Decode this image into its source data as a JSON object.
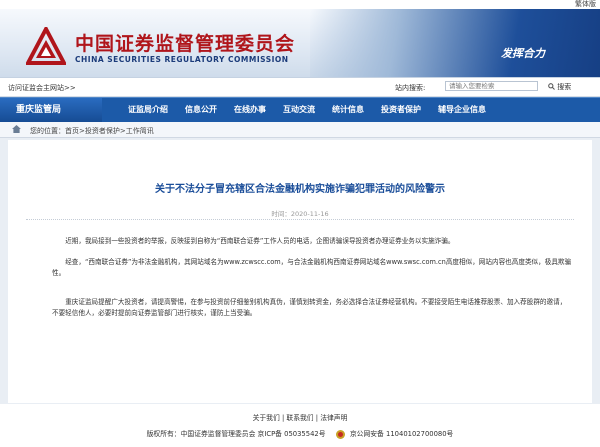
{
  "top_link": "繁体版",
  "header": {
    "org_cn": "中国证券监督管理委员会",
    "org_en": "CHINA SECURITIES REGULATORY COMMISSION",
    "slogan": "发挥合力"
  },
  "toolbar": {
    "home_link": "访问证监会主网站>>",
    "search_label": "站内搜索:",
    "search_placeholder": "请输入您要检索",
    "search_button": "搜索"
  },
  "nav": {
    "region": "重庆监管局",
    "items": [
      "证监局介绍",
      "信息公开",
      "在线办事",
      "互动交流",
      "统计信息",
      "投资者保护",
      "辅导企业信息"
    ]
  },
  "breadcrumb": "您的位置：首页>投资者保护>工作简讯",
  "article": {
    "title": "关于不法分子冒充辖区合法金融机构实施诈骗犯罪活动的风险警示",
    "date": "时间：2020-11-16",
    "paragraphs": [
      "近期，我局接到一些投资者的举报，反映接到自称为“西南联合证券”工作人员的电话，企图诱骗误导投资者办理证券业务以实施诈骗。",
      "经查，“西南联合证券”为非法金融机构，其网站域名为www.zcwscc.com，与合法金融机构西南证券网站域名www.swsc.com.cn高度相似，网站内容也高度类似，极具欺骗性。",
      "重庆证监局提醒广大投资者，请提高警惕，在参与投资前仔细鉴别机构真伪，谨慎划转资金，务必选择合法证券经营机构。不要接受陌生电话推荐股票、加入荐股群的邀请，不要轻信他人，必要时提前向证券监管部门进行核实，谨防上当受骗。"
    ]
  },
  "footer": {
    "links": "关于我们 | 联系我们 | 法律声明",
    "copyright": "版权所有：中国证券监督管理委员会 京ICP备 05035542号",
    "police": "京公网安备 11040102700080号"
  },
  "colors": {
    "brand_red": "#b0151b",
    "nav_blue": "#1c5aa8",
    "title_blue": "#1a4d99"
  }
}
